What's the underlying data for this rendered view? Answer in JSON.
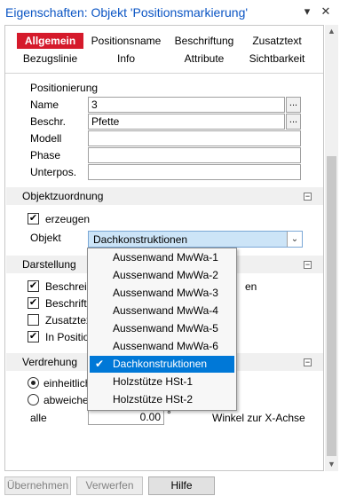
{
  "window": {
    "title": "Eigenschaften: Objekt 'Positionsmarkierung'",
    "pin_icon": "pin-icon",
    "close_icon": "close-icon"
  },
  "tabs": [
    {
      "label": "Allgemein",
      "active": true
    },
    {
      "label": "Positionsname"
    },
    {
      "label": "Beschriftung"
    },
    {
      "label": "Zusatztext"
    },
    {
      "label": "Bezugslinie"
    },
    {
      "label": "Info"
    },
    {
      "label": "Attribute"
    },
    {
      "label": "Sichtbarkeit"
    }
  ],
  "positionierung": {
    "heading": "Positionierung",
    "name_label": "Name",
    "name_value": "3",
    "beschr_label": "Beschr.",
    "beschr_value": "Pfette",
    "modell_label": "Modell",
    "modell_value": "",
    "phase_label": "Phase",
    "phase_value": "",
    "unterpos_label": "Unterpos.",
    "unterpos_value": "",
    "ellipsis": "..."
  },
  "objektzuordnung": {
    "heading": "Objektzuordnung",
    "erzeugen_label": "erzeugen",
    "erzeugen_checked": true,
    "objekt_label": "Objekt",
    "objekt_value": "Dachkonstruktionen"
  },
  "darstellung": {
    "heading": "Darstellung",
    "items": [
      {
        "label": "Beschreib",
        "checked": true
      },
      {
        "label": "Beschriftu",
        "checked": true
      },
      {
        "label": "Zusatztex",
        "checked": false
      },
      {
        "label": "In Position",
        "checked": true
      }
    ],
    "right_fragment": "en"
  },
  "verdrehung": {
    "heading": "Verdrehung",
    "option1": "einheitlich",
    "option2": "abweichen",
    "option1_selected": true,
    "alle_label": "alle",
    "alle_value": "0.00",
    "unit": "°",
    "winkel_label": "Winkel zur X-Achse"
  },
  "dropdown": {
    "items": [
      {
        "label": "Aussenwand MwWa-1"
      },
      {
        "label": "Aussenwand MwWa-2"
      },
      {
        "label": "Aussenwand MwWa-3"
      },
      {
        "label": "Aussenwand MwWa-4"
      },
      {
        "label": "Aussenwand MwWa-5"
      },
      {
        "label": "Aussenwand MwWa-6"
      },
      {
        "label": "Dachkonstruktionen",
        "selected": true
      },
      {
        "label": "Holzstütze HSt-1"
      },
      {
        "label": "Holzstütze HSt-2"
      }
    ],
    "check_mark": "✔"
  },
  "buttons": {
    "uebernehmen": "Übernehmen",
    "verwerfen": "Verwerfen",
    "hilfe": "Hilfe"
  },
  "colors": {
    "title": "#0b55c4",
    "active_tab": "#d51a2b",
    "selection": "#0078d7",
    "combo_bg": "#cce4f7"
  }
}
